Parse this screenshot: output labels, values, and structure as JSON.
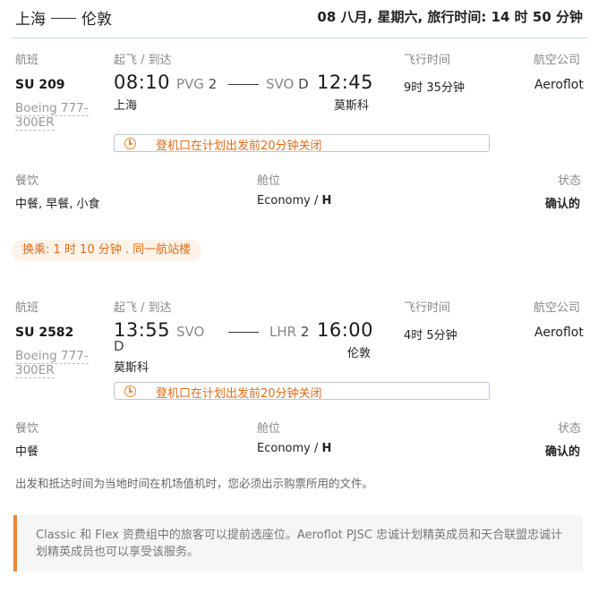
{
  "header": {
    "origin": "上海",
    "destination": "伦敦",
    "summary": "08 八月, 星期六, 旅行时间:  14 时 50 分钟"
  },
  "labels": {
    "flight": "航班",
    "depart_arrive": "起飞 / 到达",
    "duration": "飞行时间",
    "airline": "航空公司",
    "meals": "餐饮",
    "cabin": "舱位",
    "status": "状态"
  },
  "segments": [
    {
      "flight_no": "SU 209",
      "aircraft_a": "Boeing 777-",
      "aircraft_b": "300ER",
      "dep_time": "08:10",
      "dep_airport": "PVG",
      "dep_terminal": "2",
      "dep_city": "上海",
      "arr_airport": "SVO",
      "arr_terminal": "D",
      "arr_time": "12:45",
      "arr_city": "莫斯科",
      "duration": "9时 35分钟",
      "airline": "Aeroflot",
      "notice": "登机口在计划出发前20分钟关闭",
      "meals": "中餐, 早餐, 小食",
      "cabin": "Economy",
      "class": "H",
      "status": "确认的"
    },
    {
      "flight_no": "SU 2582",
      "aircraft_a": "Boeing 777-",
      "aircraft_b": "300ER",
      "dep_time": "13:55",
      "dep_airport": "SVO",
      "dep_terminal": "D",
      "dep_city": "莫斯科",
      "arr_airport": "LHR",
      "arr_terminal": "2",
      "arr_time": "16:00",
      "arr_city": "伦敦",
      "duration": "4时 5分钟",
      "airline": "Aeroflot",
      "notice": "登机口在计划出发前20分钟关闭",
      "meals": "中餐",
      "cabin": "Economy",
      "class": "H",
      "status": "确认的"
    }
  ],
  "transfer": "换乘:  1 时 10 分钟 . 同一航站楼",
  "footnote": "出发和抵达时间为当地时间在机场值机时，您必须出示购票所用的文件。",
  "info": "Classic 和 Flex 资费组中的旅客可以提前选座位。Aeroflot PJSC 忠诚计划精英成员和天合联盟忠诚计划精英成员也可以享受该服务。",
  "colors": {
    "accent": "#e8893b",
    "notice_text": "#e06c1a",
    "rule": "#bfe3dc"
  }
}
